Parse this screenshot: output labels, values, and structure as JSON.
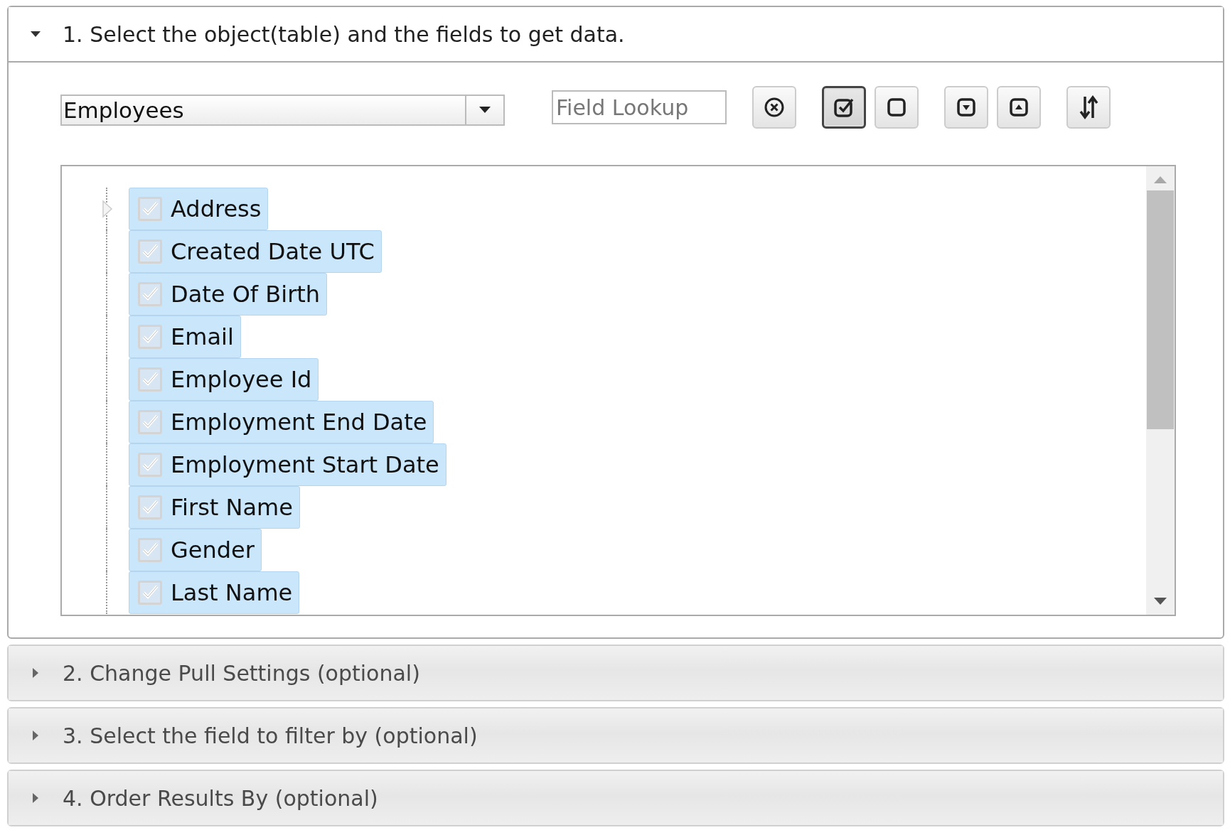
{
  "panels": [
    {
      "title": "1. Select the object(table) and the fields to get data.",
      "expanded": true
    },
    {
      "title": "2. Change Pull Settings (optional)",
      "expanded": false
    },
    {
      "title": "3. Select the field to filter by (optional)",
      "expanded": false
    },
    {
      "title": "4. Order Results By (optional)",
      "expanded": false
    }
  ],
  "object_select": {
    "value": "Employees"
  },
  "field_lookup": {
    "placeholder": "Field Lookup"
  },
  "toolbar_buttons": [
    {
      "kind": "clear",
      "pressed": false
    },
    {
      "kind": "check_all",
      "pressed": true
    },
    {
      "kind": "uncheck_all",
      "pressed": false
    },
    {
      "kind": "expand_all",
      "pressed": false
    },
    {
      "kind": "collapse_all",
      "pressed": false
    },
    {
      "kind": "sort",
      "pressed": false
    }
  ],
  "fields": [
    {
      "label": "Address",
      "checked": true,
      "expandable": true
    },
    {
      "label": "Created Date UTC",
      "checked": true,
      "expandable": false
    },
    {
      "label": "Date Of Birth",
      "checked": true,
      "expandable": false
    },
    {
      "label": "Email",
      "checked": true,
      "expandable": false
    },
    {
      "label": "Employee Id",
      "checked": true,
      "expandable": false
    },
    {
      "label": "Employment End Date",
      "checked": true,
      "expandable": false
    },
    {
      "label": "Employment Start Date",
      "checked": true,
      "expandable": false
    },
    {
      "label": "First Name",
      "checked": true,
      "expandable": false
    },
    {
      "label": "Gender",
      "checked": true,
      "expandable": false
    },
    {
      "label": "Last Name",
      "checked": true,
      "expandable": false
    }
  ]
}
